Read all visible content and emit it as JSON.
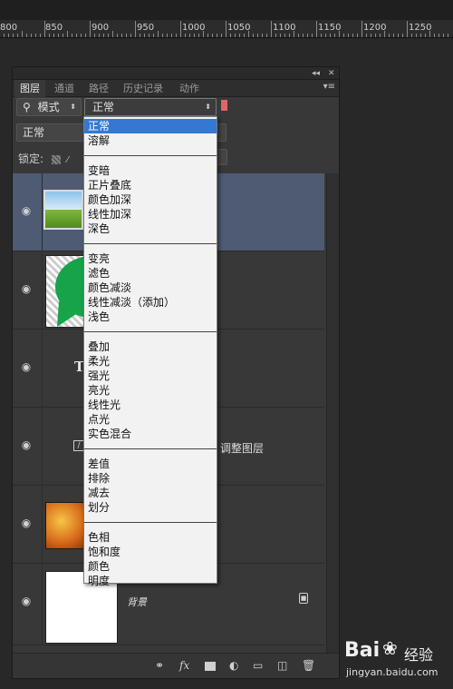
{
  "ruler": {
    "labels": [
      "800",
      "850",
      "900",
      "950",
      "1000",
      "1050",
      "1100",
      "1150",
      "1200",
      "1250"
    ]
  },
  "panel": {
    "collapse_label": "◂◂",
    "close_label": "✕",
    "tabs": [
      "图层",
      "通道",
      "路径",
      "历史记录",
      "动作"
    ],
    "menu_label": "▾≡"
  },
  "filter": {
    "icon_label": "⚲",
    "label": "模式"
  },
  "blend_mode_current": "正常",
  "blend_mode_select": "正常",
  "lock_label": "锁定:",
  "dropdown": {
    "groups": [
      [
        "正常",
        "溶解"
      ],
      [
        "变暗",
        "正片叠底",
        "颜色加深",
        "线性加深",
        "深色"
      ],
      [
        "变亮",
        "滤色",
        "颜色减淡",
        "线性减淡（添加）",
        "浅色"
      ],
      [
        "叠加",
        "柔光",
        "强光",
        "亮光",
        "线性光",
        "点光",
        "实色混合"
      ],
      [
        "差值",
        "排除",
        "减去",
        "划分"
      ],
      [
        "色相",
        "饱和度",
        "颜色",
        "明度"
      ]
    ],
    "selected": "正常"
  },
  "layers": [
    {
      "name": "",
      "selected": true
    },
    {
      "name": ""
    },
    {
      "name": "T"
    },
    {
      "name": "调整图层"
    },
    {
      "name": ""
    },
    {
      "name": "背景"
    }
  ],
  "watermark": {
    "brand": "Bai",
    "brand_suffix": "经验",
    "url": "jingyan.baidu.com"
  },
  "colors": {
    "selected_layer": "#4f5a73",
    "menu_highlight": "#3478d4",
    "stamp": "#e06666"
  }
}
